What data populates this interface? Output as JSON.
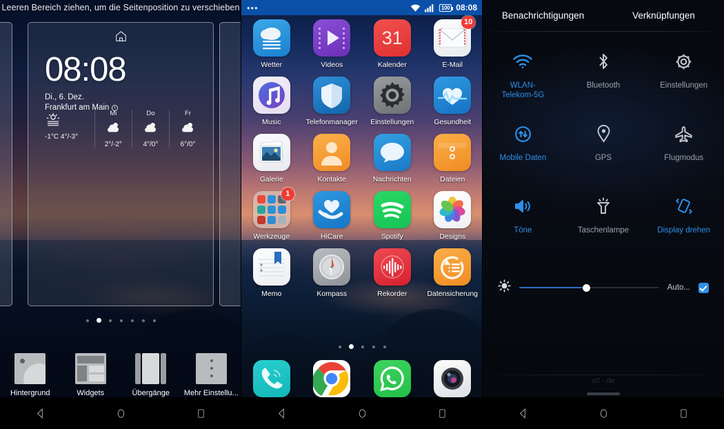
{
  "panel1": {
    "name": "homescreen-edit-mode",
    "hint": "Leeren Bereich ziehen, um die Seitenposition zu verschieben",
    "home_icon": "home-icon",
    "widget": {
      "clock": "08:08",
      "date": "Di., 6. Dez.",
      "city": "Frankfurt am Main",
      "location_icon": "location-icon",
      "today": {
        "icon": "sun-fog-icon",
        "temp": "-1°C 4°/-3°"
      },
      "forecast": [
        {
          "day": "Mi",
          "icon": "partly-cloudy-icon",
          "temp": "2°/-2°"
        },
        {
          "day": "Do",
          "icon": "partly-cloudy-icon",
          "temp": "4°/0°"
        },
        {
          "day": "Fr",
          "icon": "partly-cloudy-icon",
          "temp": "6°/0°"
        }
      ]
    },
    "page_dots": {
      "count": 7,
      "active_index": 1
    },
    "toolbar": [
      {
        "icon": "wallpaper-icon",
        "label": "Hintergrund"
      },
      {
        "icon": "widgets-icon",
        "label": "Widgets"
      },
      {
        "icon": "transitions-icon",
        "label": "Übergänge"
      },
      {
        "icon": "more-settings-icon",
        "label": "Mehr Einstellu..."
      }
    ]
  },
  "panel2": {
    "name": "homescreen",
    "statusbar": {
      "left_icon": "overflow-dots-icon",
      "wifi_icon": "wifi-icon",
      "signal_icon": "signal-bars-icon",
      "battery_text": "100",
      "time": "08:08"
    },
    "rows": [
      [
        {
          "label": "Wetter",
          "icon": "weather-app-icon"
        },
        {
          "label": "Videos",
          "icon": "videos-app-icon"
        },
        {
          "label": "Kalender",
          "icon": "calendar-app-icon",
          "icon_text": "31"
        },
        {
          "label": "E-Mail",
          "icon": "email-app-icon",
          "badge": "10"
        }
      ],
      [
        {
          "label": "Music",
          "icon": "music-app-icon"
        },
        {
          "label": "Telefonmanager",
          "icon": "phone-manager-app-icon"
        },
        {
          "label": "Einstellungen",
          "icon": "settings-app-icon"
        },
        {
          "label": "Gesundheit",
          "icon": "health-app-icon"
        }
      ],
      [
        {
          "label": "Galerie",
          "icon": "gallery-app-icon"
        },
        {
          "label": "Kontakte",
          "icon": "contacts-app-icon"
        },
        {
          "label": "Nachrichten",
          "icon": "messages-app-icon"
        },
        {
          "label": "Dateien",
          "icon": "files-app-icon"
        }
      ],
      [
        {
          "label": "Werkzeuge",
          "icon": "tools-folder-icon",
          "badge": "1"
        },
        {
          "label": "HiCare",
          "icon": "hicare-app-icon"
        },
        {
          "label": "Spotify",
          "icon": "spotify-app-icon"
        },
        {
          "label": "Designs",
          "icon": "themes-app-icon"
        }
      ],
      [
        {
          "label": "Memo",
          "icon": "memo-app-icon"
        },
        {
          "label": "Kompass",
          "icon": "compass-app-icon"
        },
        {
          "label": "Rekorder",
          "icon": "recorder-app-icon"
        },
        {
          "label": "Datensicherung",
          "icon": "backup-app-icon"
        }
      ]
    ],
    "page_dots": {
      "count": 5,
      "active_index": 1
    },
    "dock": [
      {
        "label": "Telefon",
        "icon": "phone-app-icon"
      },
      {
        "label": "Chrome",
        "icon": "chrome-app-icon"
      },
      {
        "label": "WhatsApp",
        "icon": "whatsapp-app-icon"
      },
      {
        "label": "Kamera",
        "icon": "camera-app-icon"
      }
    ]
  },
  "panel3": {
    "name": "quick-settings-shade",
    "tabs": [
      {
        "label": "Benachrichtigungen",
        "active": false
      },
      {
        "label": "Verknüpfungen",
        "active": true
      }
    ],
    "toggles": [
      {
        "label": "WLAN-\nTelekom-5G",
        "icon": "wifi-icon",
        "on": true
      },
      {
        "label": "Bluetooth",
        "icon": "bluetooth-icon",
        "on": false
      },
      {
        "label": "Einstellungen",
        "icon": "gear-icon",
        "on": false
      },
      {
        "label": "Mobile Daten",
        "icon": "mobile-data-icon",
        "on": true
      },
      {
        "label": "GPS",
        "icon": "location-pin-icon",
        "on": false
      },
      {
        "label": "Flugmodus",
        "icon": "airplane-icon",
        "on": false
      },
      {
        "label": "Töne",
        "icon": "speaker-icon",
        "on": true
      },
      {
        "label": "Taschenlampe",
        "icon": "flashlight-icon",
        "on": false
      },
      {
        "label": "Display drehen",
        "icon": "rotate-screen-icon",
        "on": true
      }
    ],
    "brightness": {
      "icon": "brightness-icon",
      "value_percent": 48,
      "auto_label": "Auto...",
      "auto_checked": true
    },
    "carrier": "o2 - de",
    "accent_color": "#2e8fe8"
  },
  "navbar": {
    "back": "back-triangle-icon",
    "home": "home-circle-icon",
    "recents": "recents-square-icon"
  }
}
